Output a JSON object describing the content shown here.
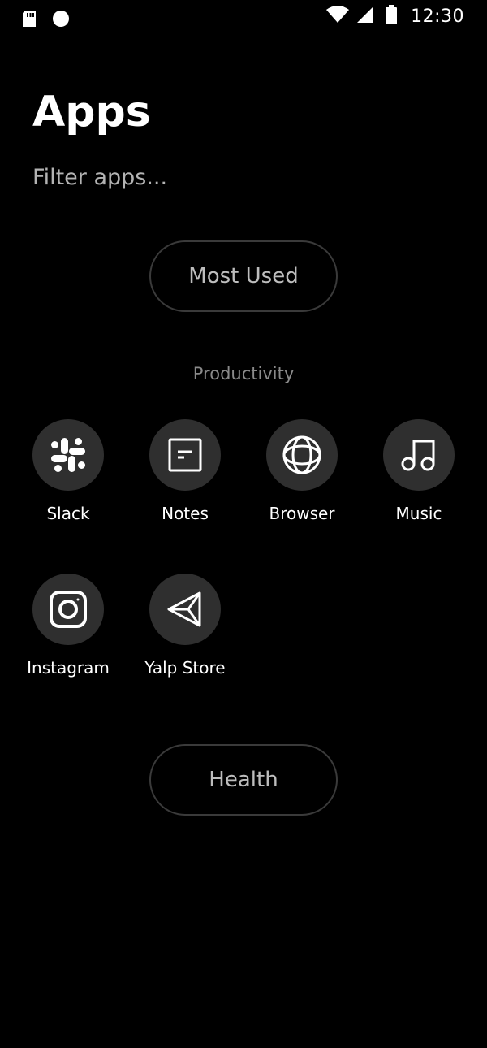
{
  "status_bar": {
    "time": "12:30",
    "icons": [
      "sd-card-icon",
      "dot-icon",
      "wifi-icon",
      "signal-icon",
      "battery-icon"
    ]
  },
  "header": {
    "title": "Apps"
  },
  "search": {
    "placeholder": "Filter apps..."
  },
  "buttons": {
    "most_used": "Most Used",
    "health": "Health"
  },
  "sections": {
    "productivity": "Productivity"
  },
  "apps": [
    {
      "label": "Slack",
      "icon": "slack-icon"
    },
    {
      "label": "Notes",
      "icon": "notes-icon"
    },
    {
      "label": "Browser",
      "icon": "globe-icon"
    },
    {
      "label": "Music",
      "icon": "music-note-icon"
    },
    {
      "label": "Instagram",
      "icon": "instagram-icon"
    },
    {
      "label": "Yalp Store",
      "icon": "paper-plane-icon"
    }
  ],
  "colors": {
    "background": "#000000",
    "icon_circle": "#2f2f2f",
    "pill_border": "#3a3a3a",
    "muted_text": "#8a8a8a"
  }
}
